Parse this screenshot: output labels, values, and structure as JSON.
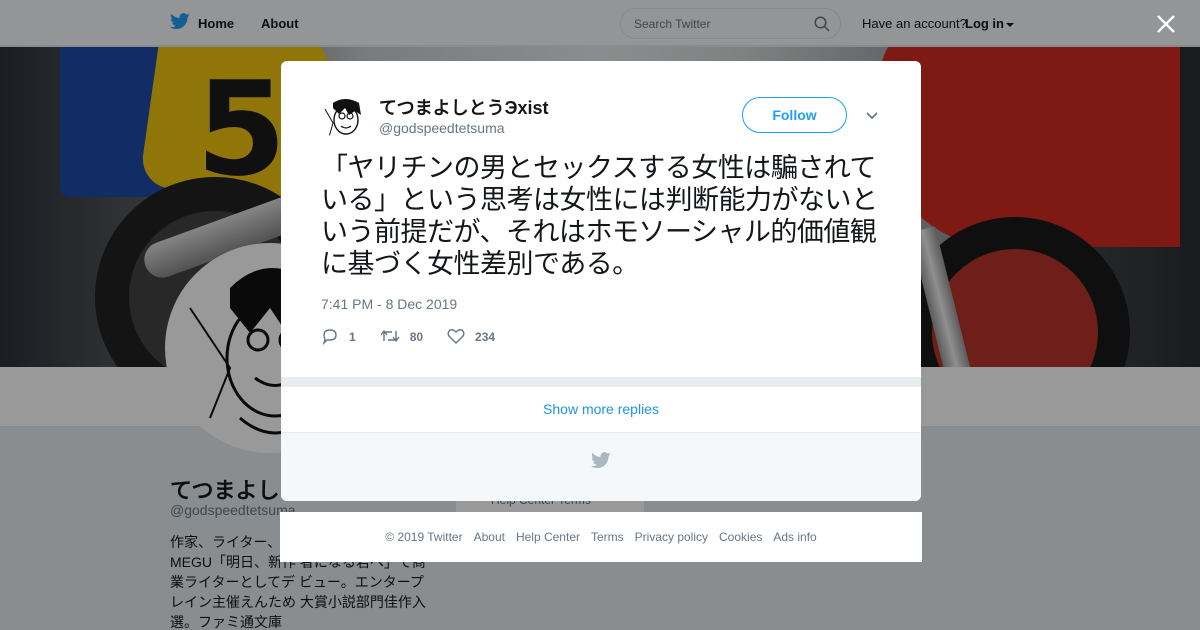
{
  "nav": {
    "home_label": "Home",
    "about_label": "About",
    "search_placeholder": "Search Twitter",
    "have_account": "Have an account?",
    "login_label": "Log in"
  },
  "profile": {
    "name": "てつまよしとう",
    "handle": "@godspeedtetsuma",
    "bio": "作家、ライター、 る名義でアニメ雑誌MEGU「明日、新作 者になる君へ」で商業ライターとしてデ ビュー。エンタープレイン主催えんため 大賞小説部門佳作入選。ファミ通文庫",
    "side_links": "Help Center  Terms"
  },
  "tweet": {
    "author_name": "てつまよしとうЭxist",
    "author_handle": "@godspeedtetsuma",
    "follow_label": "Follow",
    "text": "「ヤリチンの男とセックスする女性は騙されている」という思考は女性には判断能力がないという前提だが、それはホモソーシャル的価値観に基づく女性差別である。",
    "timestamp": "7:41 PM - 8 Dec 2019",
    "replies": "1",
    "retweets": "80",
    "likes": "234",
    "show_more_replies": "Show more replies"
  },
  "footer": {
    "links": [
      "© 2019 Twitter",
      "About",
      "Help Center",
      "Terms",
      "Privacy policy",
      "Cookies",
      "Ads info"
    ]
  },
  "colors": {
    "brand_blue": "#1da1f2",
    "link_blue": "#1b95e0",
    "text_primary": "#14171a",
    "text_secondary": "#657786"
  },
  "icons": [
    "twitter-bird-icon",
    "search-icon",
    "close-icon",
    "chevron-down-icon",
    "reply-icon",
    "retweet-icon",
    "like-icon"
  ]
}
